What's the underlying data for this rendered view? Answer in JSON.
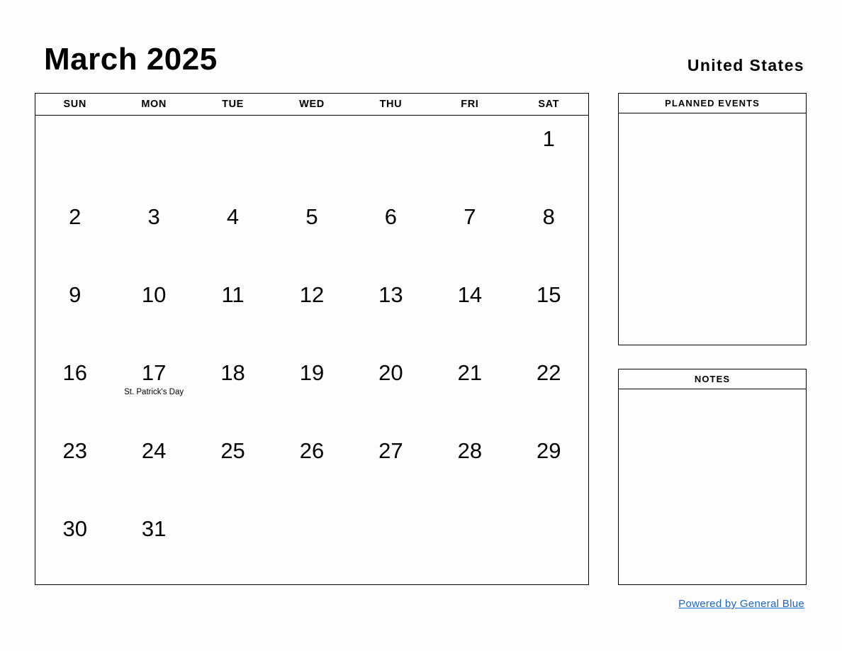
{
  "header": {
    "month_title": "March 2025",
    "country": "United States"
  },
  "calendar": {
    "weekdays": [
      "SUN",
      "MON",
      "TUE",
      "WED",
      "THU",
      "FRI",
      "SAT"
    ],
    "weeks": [
      [
        {
          "day": "",
          "event": ""
        },
        {
          "day": "",
          "event": ""
        },
        {
          "day": "",
          "event": ""
        },
        {
          "day": "",
          "event": ""
        },
        {
          "day": "",
          "event": ""
        },
        {
          "day": "",
          "event": ""
        },
        {
          "day": "1",
          "event": ""
        }
      ],
      [
        {
          "day": "2",
          "event": ""
        },
        {
          "day": "3",
          "event": ""
        },
        {
          "day": "4",
          "event": ""
        },
        {
          "day": "5",
          "event": ""
        },
        {
          "day": "6",
          "event": ""
        },
        {
          "day": "7",
          "event": ""
        },
        {
          "day": "8",
          "event": ""
        }
      ],
      [
        {
          "day": "9",
          "event": ""
        },
        {
          "day": "10",
          "event": ""
        },
        {
          "day": "11",
          "event": ""
        },
        {
          "day": "12",
          "event": ""
        },
        {
          "day": "13",
          "event": ""
        },
        {
          "day": "14",
          "event": ""
        },
        {
          "day": "15",
          "event": ""
        }
      ],
      [
        {
          "day": "16",
          "event": ""
        },
        {
          "day": "17",
          "event": "St. Patrick's Day"
        },
        {
          "day": "18",
          "event": ""
        },
        {
          "day": "19",
          "event": ""
        },
        {
          "day": "20",
          "event": ""
        },
        {
          "day": "21",
          "event": ""
        },
        {
          "day": "22",
          "event": ""
        }
      ],
      [
        {
          "day": "23",
          "event": ""
        },
        {
          "day": "24",
          "event": ""
        },
        {
          "day": "25",
          "event": ""
        },
        {
          "day": "26",
          "event": ""
        },
        {
          "day": "27",
          "event": ""
        },
        {
          "day": "28",
          "event": ""
        },
        {
          "day": "29",
          "event": ""
        }
      ],
      [
        {
          "day": "30",
          "event": ""
        },
        {
          "day": "31",
          "event": ""
        },
        {
          "day": "",
          "event": ""
        },
        {
          "day": "",
          "event": ""
        },
        {
          "day": "",
          "event": ""
        },
        {
          "day": "",
          "event": ""
        },
        {
          "day": "",
          "event": ""
        }
      ]
    ]
  },
  "panels": {
    "planned_events": {
      "title": "PLANNED EVENTS",
      "content": ""
    },
    "notes": {
      "title": "NOTES",
      "content": ""
    }
  },
  "footer": {
    "link_text": "Powered by General Blue"
  },
  "colors": {
    "page_background": "#fdfdfd",
    "border": "#000000",
    "text": "#000000",
    "link": "#1a66cc"
  }
}
